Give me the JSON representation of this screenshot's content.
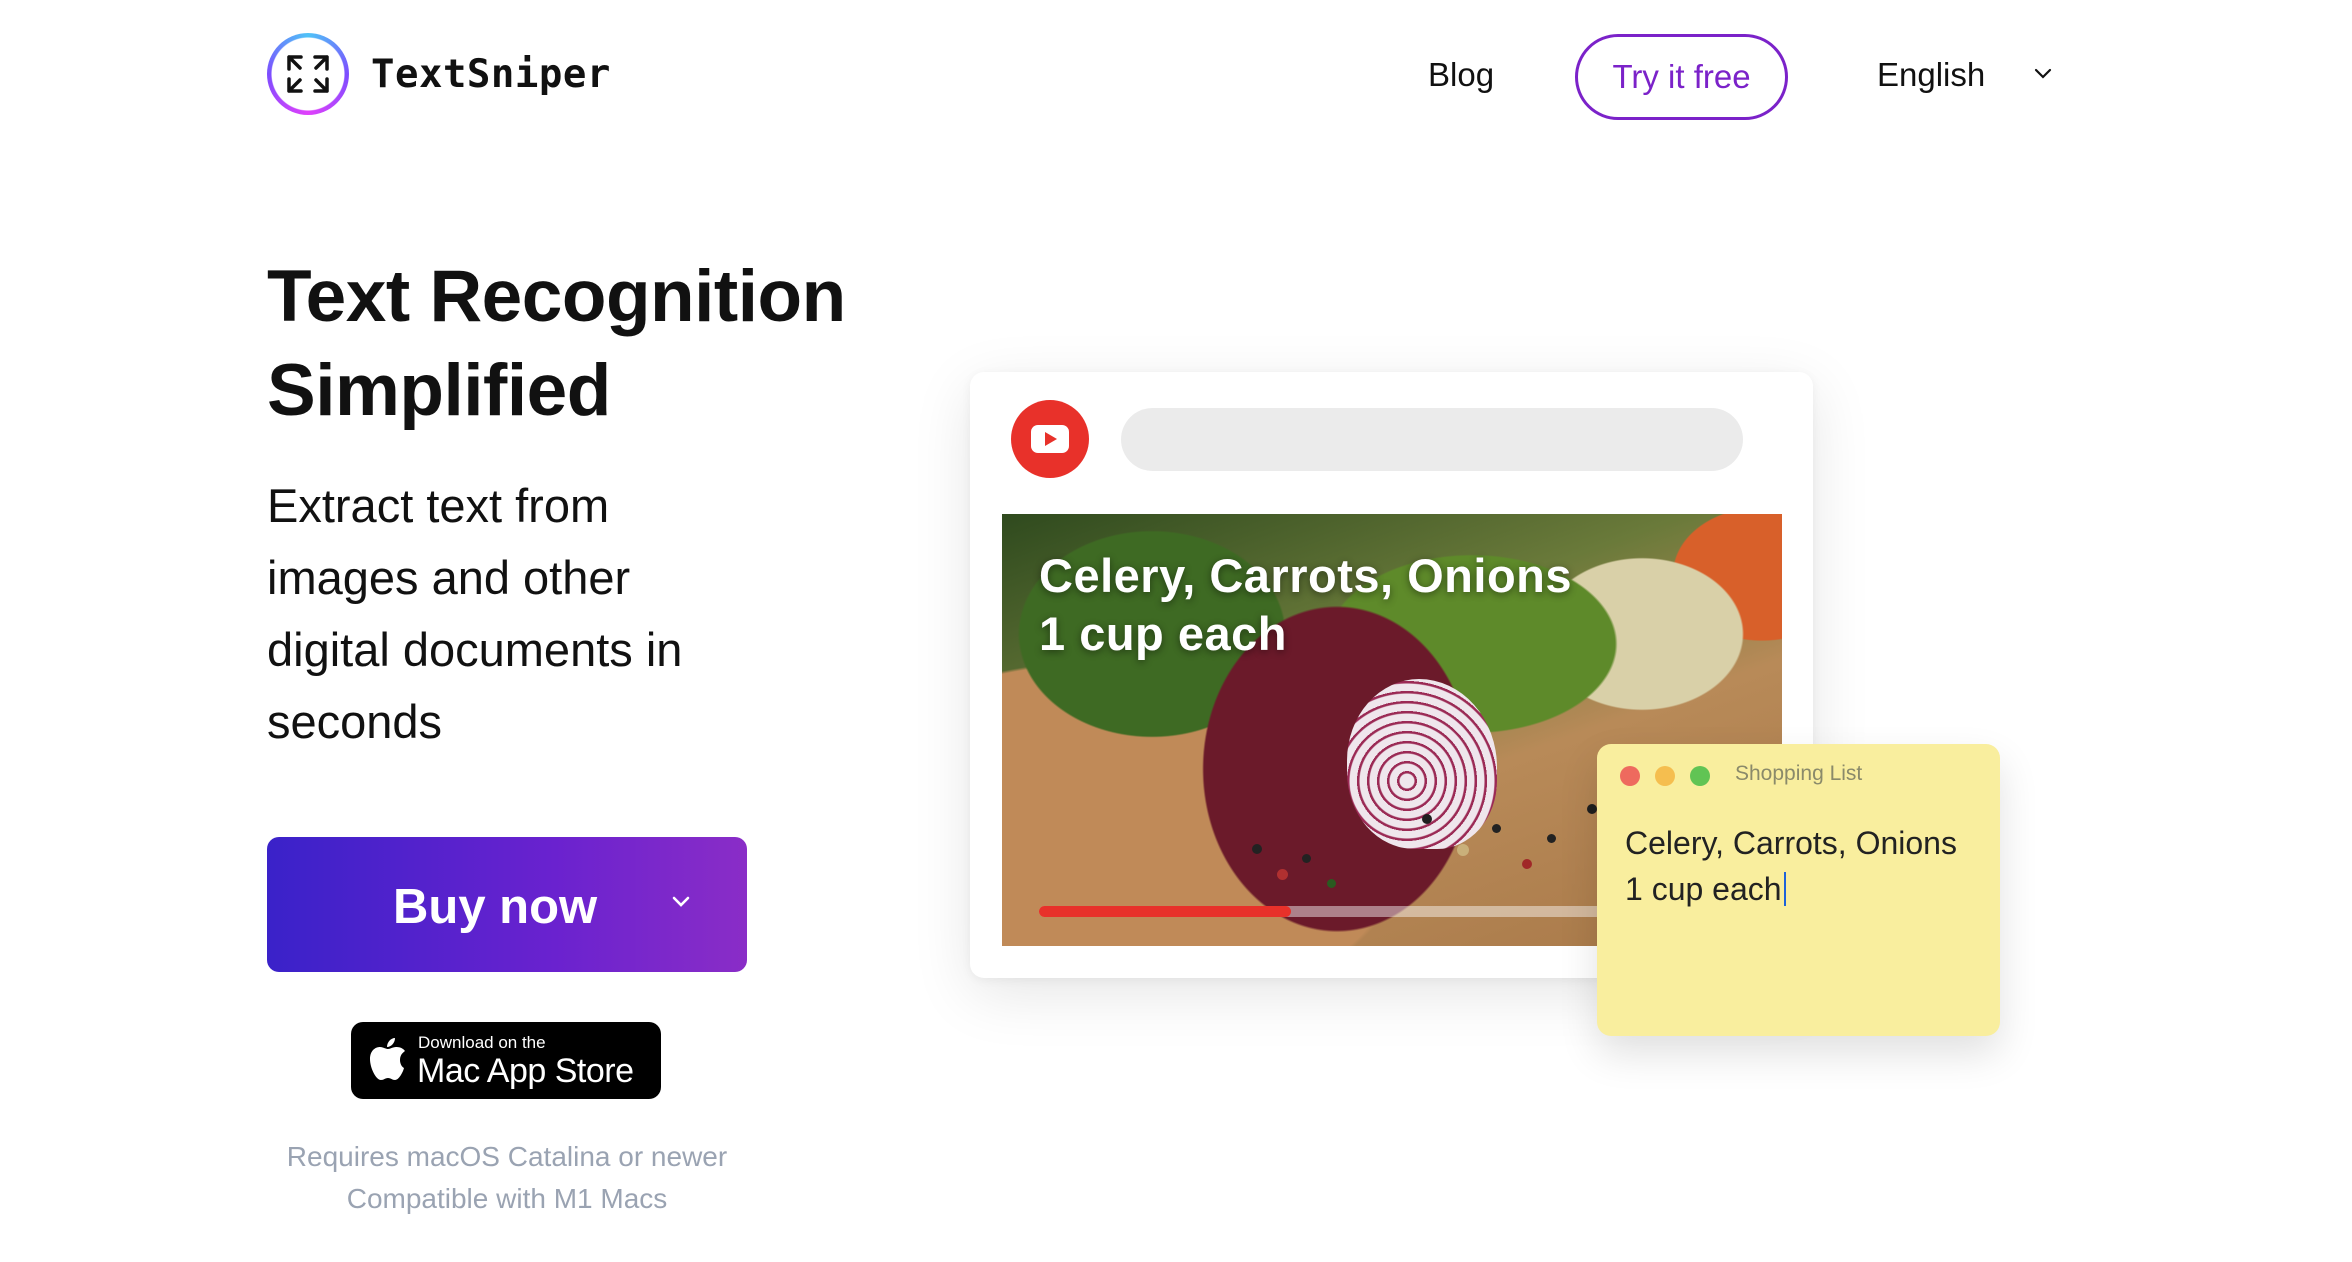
{
  "header": {
    "brand": "TextSniper",
    "logo_icon": "corner-arrows-icon",
    "nav": {
      "blog": "Blog",
      "try_free": "Try it free",
      "language": "English",
      "language_icon": "chevron-down-icon"
    }
  },
  "hero": {
    "title_line1": "Text Recognition",
    "title_line2": "Simplified",
    "subtitle_lines": [
      "Extract text from",
      "images and other",
      "digital documents in",
      "seconds"
    ],
    "buy_button": "Buy now",
    "buy_caret_icon": "chevron-down-icon",
    "app_store": {
      "small": "Download on the",
      "big": "Mac App Store",
      "icon": "apple-icon"
    },
    "requirements": [
      "Requires macOS Catalina or newer",
      "Compatible with M1 Macs"
    ]
  },
  "demo": {
    "browser": {
      "site_icon": "youtube-play-icon",
      "video_caption_line1": "Celery, Carrots, Onions",
      "video_caption_line2": "1 cup each",
      "video_progress": 0.36
    },
    "note": {
      "title": "Shopping List",
      "line1": "Celery, Carrots, Onions",
      "line2": "1 cup each"
    }
  },
  "colors": {
    "accent_purple": "#7b22c9",
    "buy_gradient_start": "#3a22c9",
    "buy_gradient_end": "#8a2dc7",
    "youtube_red": "#e8312a",
    "note_yellow": "#f9ee9e",
    "muted_text": "#9aa3b2"
  }
}
